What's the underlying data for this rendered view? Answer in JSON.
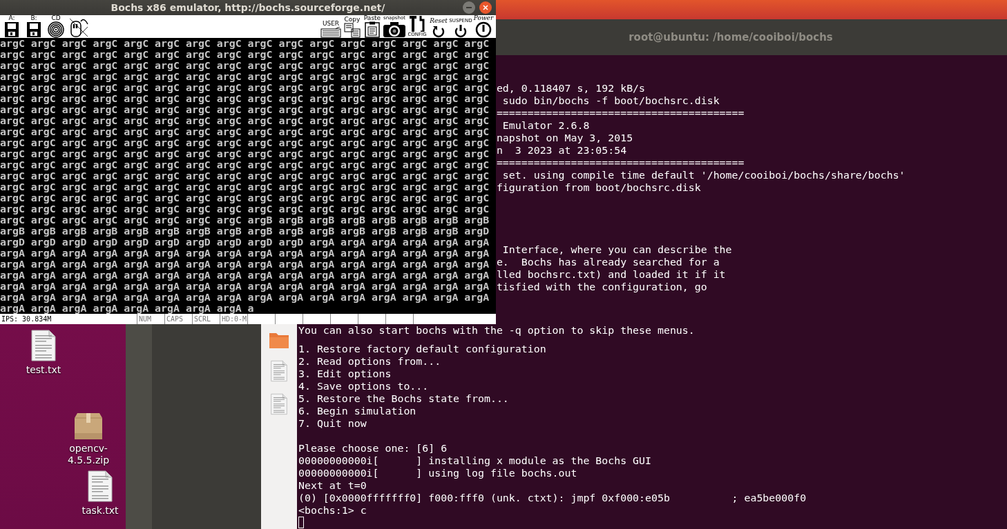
{
  "bochs_window": {
    "title": "Bochs x86 emulator, http://bochs.sourceforge.net/",
    "toolbar_left": [
      {
        "kind": "floppy",
        "label": "A:"
      },
      {
        "kind": "floppy",
        "label": "B:"
      },
      {
        "kind": "cdrom",
        "label": "CD"
      },
      {
        "kind": "mouse"
      }
    ],
    "toolbar_right": [
      {
        "kind": "keyboard",
        "label": "USER"
      },
      {
        "kind": "copy",
        "label": "Copy"
      },
      {
        "kind": "paste",
        "label": "Paste"
      },
      {
        "kind": "snapshot",
        "label": "snapshot"
      },
      {
        "kind": "config",
        "label": "CONFIG"
      },
      {
        "kind": "reset",
        "label": "Reset"
      },
      {
        "kind": "suspend",
        "label": "SUSPEND"
      },
      {
        "kind": "power",
        "label": "Power"
      }
    ],
    "screen_rows": [
      "argC argC argC argC argC argC argC argC argC argC argC argC argC argC argC argC",
      "argC argC argC argC argC argC argC argC argC argC argC argC argC argC argC argC",
      "argC argC argC argC argC argC argC argC argC argC argC argC argC argC argC argC",
      "argC argC argC argC argC argC argC argC argC argC argC argC argC argC argC argC",
      "argC argC argC argC argC argC argC argC argC argC argC argC argC argC argC argC",
      "argC argC argC argC argC argC argC argC argC argC argC argC argC argC argC argC",
      "argC argC argC argC argC argC argC argC argC argC argC argC argC argC argC argC",
      "argC argC argC argC argC argC argC argC argC argC argC argC argC argC argC argC",
      "argC argC argC argC argC argC argC argC argC argC argC argC argC argC argC argC",
      "argC argC argC argC argC argC argC argC argC argC argC argC argC argC argC argC",
      "argC argC argC argC argC argC argC argC argC argC argC argC argC argC argC argC",
      "argC argC argC argC argC argC argC argC argC argC argC argC argC argC argC argC",
      "argC argC argC argC argC argC argC argC argC argC argC argC argC argC argC argC",
      "argC argC argC argC argC argC argC argC argC argC argC argC argC argC argC argC",
      "argC argC argC argC argC argC argC argC argC argC argC argC argC argC argC argC",
      "argC argC argC argC argC argC argC argC argC argC argC argC argC argC argC argC",
      "argC argC argC argC argC argC argC argC argB argB argB argB argB argB argB argB",
      "argB argB argB argB argB argB argB argB argB argB argB argB argB argB argB argD",
      "argD argD argD argD argD argD argD argD argD argD argA argA argA argA argA argA",
      "argA argA argA argA argA argA argA argA argA argA argA argA argA argA argA argA",
      "argA argA argA argA argA argA argA argA argA argA argA argA argA argA argA argA",
      "argA argA argA argA argA argA argA argA argA argA argA argA argA argA argA argA",
      "argA argA argA argA argA argA argA argA argA argA argA argA argA argA argA argA",
      "argA argA argA argA argA argA argA argA argA argA argA argA argA argA argA argA",
      "argA argA argA argA argA argA argA argA a"
    ],
    "status_bar": [
      "IPS: 30.834M",
      "NUM",
      "CAPS",
      "SCRL",
      "HD:0-M"
    ]
  },
  "terminal": {
    "title": "root@ubuntu: /home/cooiboi/bochs",
    "blocks": [
      {
        "lines": [
          {
            "text": "ed, 0.118407 s, 192 kB/s",
            "covered": true
          },
          {
            "text": " sudo bin/bochs -f boot/bochsrc.disk",
            "covered": true
          },
          {
            "text": "========================================",
            "covered": true
          },
          {
            "text": " Emulator 2.6.8",
            "covered": true
          },
          {
            "text": "napshot on May 3, 2015",
            "covered": true
          },
          {
            "text": "n  3 2023 at 23:05:54",
            "covered": true
          },
          {
            "text": "========================================",
            "covered": true
          },
          {
            "text": " set. using compile time default '/home/cooiboi/bochs/share/bochs'",
            "covered": true
          },
          {
            "text": "figuration from boot/bochsrc.disk",
            "covered": true
          }
        ]
      },
      {
        "lines": [
          {
            "text": " Interface, where you can describe the",
            "covered": true
          },
          {
            "text": "e.  Bochs has already searched for a",
            "covered": true
          },
          {
            "text": "lled bochsrc.txt) and loaded it if it",
            "covered": true
          },
          {
            "text": "tisfied with the configuration, go",
            "covered": true
          }
        ]
      },
      {
        "lines": [
          {
            "text": "You can also start bochs with the -q option to skip these menus.",
            "covered": false
          }
        ]
      },
      {
        "lines": [
          {
            "text": "1. Restore factory default configuration",
            "covered": false
          },
          {
            "text": "2. Read options from...",
            "covered": false
          },
          {
            "text": "3. Edit options",
            "covered": false
          },
          {
            "text": "4. Save options to...",
            "covered": false
          },
          {
            "text": "5. Restore the Bochs state from...",
            "covered": false
          },
          {
            "text": "6. Begin simulation",
            "covered": false
          },
          {
            "text": "7. Quit now",
            "covered": false
          }
        ]
      },
      {
        "lines": [
          {
            "text": "Please choose one: [6] 6",
            "covered": false
          },
          {
            "text": "00000000000i[      ] installing x module as the Bochs GUI",
            "covered": false
          },
          {
            "text": "00000000000i[      ] using log file bochs.out",
            "covered": false
          },
          {
            "text": "Next at t=0",
            "covered": false
          },
          {
            "text": "(0) [0x0000fffffff0] f000:fff0 (unk. ctxt): jmpf 0xf000:e05b          ; ea5be000f0",
            "covered": false
          },
          {
            "text": "<bochs:1> c",
            "covered": false
          }
        ]
      }
    ]
  },
  "desktop_icons": [
    {
      "kind": "text-file",
      "label": "test.txt"
    },
    {
      "kind": "zip",
      "label": "opencv-\n4.5.5.zip"
    },
    {
      "kind": "text-file",
      "label": "task.txt"
    }
  ]
}
